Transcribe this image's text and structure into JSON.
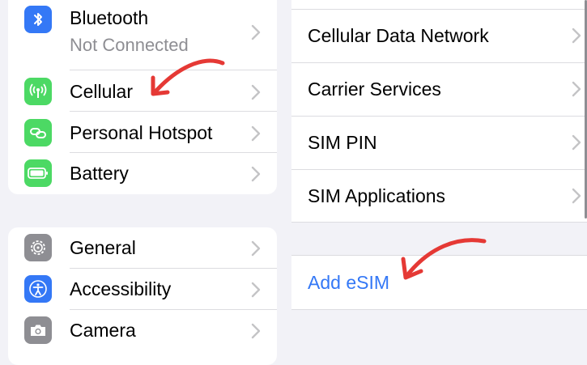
{
  "left": {
    "group1": [
      {
        "label": "Bluetooth",
        "sub": "Not Connected",
        "icon": "bluetooth-icon",
        "color": "#3478f6"
      },
      {
        "label": "Cellular",
        "icon": "cellular-antenna-icon",
        "color": "#4cd964"
      },
      {
        "label": "Personal Hotspot",
        "icon": "hotspot-link-icon",
        "color": "#4cd964"
      },
      {
        "label": "Battery",
        "icon": "battery-icon",
        "color": "#4cd964"
      }
    ],
    "group2": [
      {
        "label": "General",
        "icon": "gear-icon",
        "color": "#8e8e93"
      },
      {
        "label": "Accessibility",
        "icon": "accessibility-icon",
        "color": "#3478f6"
      },
      {
        "label": "Camera",
        "icon": "camera-icon",
        "color": "#8e8e93"
      }
    ]
  },
  "right": {
    "items": [
      {
        "label": "Cellular Data Network"
      },
      {
        "label": "Carrier Services"
      },
      {
        "label": "SIM PIN"
      },
      {
        "label": "SIM Applications"
      }
    ],
    "action": {
      "label": "Add eSIM",
      "color": "#3478f6"
    }
  },
  "annotation_color": "#e53935"
}
